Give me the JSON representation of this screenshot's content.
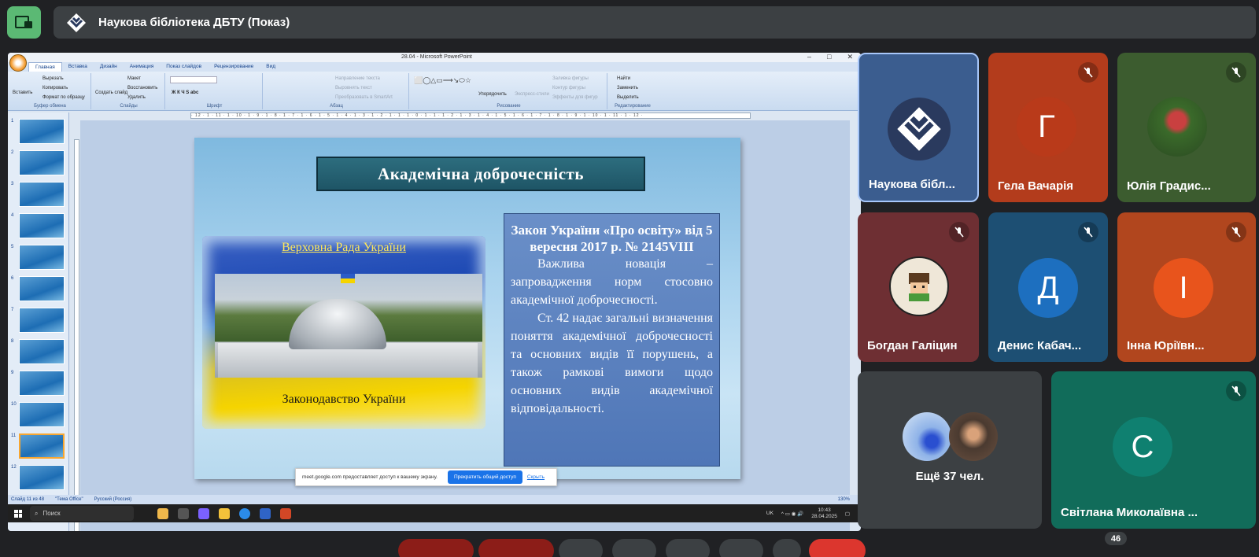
{
  "meeting": {
    "title": "Наукова бібліотека ДБТУ (Показ)",
    "present_icon": "present-screen-icon",
    "participant_count": "46"
  },
  "powerpoint": {
    "window_title": "28.04 - Microsoft PowerPoint",
    "tabs": [
      "Главная",
      "Вставка",
      "Дизайн",
      "Анимация",
      "Показ слайдов",
      "Рецензирование",
      "Вид"
    ],
    "ribbon": {
      "clipboard": {
        "label": "Буфер обмена",
        "paste": "Вставить",
        "cut": "Вырезать",
        "copy": "Копировать",
        "format": "Формат по образцу"
      },
      "slides": {
        "label": "Слайды",
        "new": "Создать слайд",
        "layout": "Макет",
        "reset": "Восстановить",
        "delete": "Удалить"
      },
      "font": {
        "label": "Шрифт"
      },
      "paragraph": {
        "label": "Абзац",
        "direction": "Направление текста",
        "align": "Выровнять текст",
        "smartart": "Преобразовать в SmartArt"
      },
      "drawing": {
        "label": "Рисование",
        "arrange": "Упорядочить",
        "styles": "Экспресс-стили",
        "fill": "Заливка фигуры",
        "outline": "Контур фигуры",
        "effects": "Эффекты для фигур"
      },
      "editing": {
        "label": "Редактирование",
        "find": "Найти",
        "replace": "Заменить",
        "select": "Выделить"
      }
    },
    "ruler_text": "· 12 · 1 · 11 · 1 · 10 · 1 · 9 · 1 · 8 · 1 · 7 · 1 · 6 · 1 · 5 · 1 · 4 · 1 · 3 · 1 · 2 · 1 · 1 · 1 · 0 · 1 · 1 · 1 · 2 · 1 · 3 · 1 · 4 · 1 · 5 · 1 · 6 · 1 · 7 · 1 · 8 · 1 · 9 · 1 · 10 · 1 · 11 · 1 · 12 ·",
    "thumb_numbers": [
      "1",
      "2",
      "3",
      "4",
      "5",
      "6",
      "7",
      "8",
      "9",
      "10",
      "11",
      "12"
    ],
    "selected_thumb": "11",
    "slide": {
      "title": "Академічна доброчесність",
      "flag_top": "Верховна Рада України",
      "flag_bottom": "Законодавство України",
      "law_heading": "Закон України «Про освіту» від 5 вересня 2017 р. № 2145VIII",
      "law_p1": "Важлива новація – запровадження норм стосовно академічної доброчесності.",
      "law_p2": "Ст. 42 надає загальні визначення поняття академічної доброчесності та основних видів її порушень, а також рамкові вимоги щодо основних видів академічної відповідальності."
    },
    "status": {
      "slide": "Слайд 11 из 48",
      "theme": "\"Тема Office\"",
      "lang": "Русский (Россия)",
      "zoom": "130%"
    }
  },
  "share_bar": {
    "text": "meet.google.com предоставляет доступ к вашему экрану.",
    "stop": "Прекратить общий доступ",
    "hide": "Скрыть"
  },
  "taskbar": {
    "search": "Поиск",
    "lang": "UK",
    "time": "10:43",
    "date": "28.04.2025"
  },
  "participants": [
    {
      "name": "Наукова бібл...",
      "color": "#3b5d8f"
    },
    {
      "name": "Гела Вачарія",
      "initial": "Г",
      "color": "#b33c1c",
      "avatar": "#b93a1a"
    },
    {
      "name": "Юлія Градис...",
      "color": "#3c5c2f"
    },
    {
      "name": "Богдан Галіцин",
      "color": "#6e2f33"
    },
    {
      "name": "Денис Кабач...",
      "initial": "Д",
      "color": "#1d4f73",
      "avatar": "#1d6fbf"
    },
    {
      "name": "Інна Юріївн...",
      "initial": "І",
      "color": "#b1461e",
      "avatar": "#e8541c"
    },
    {
      "name": "Ещё 37 чел.",
      "color": "#3c4043"
    },
    {
      "name": "Світлана Миколаївна ...",
      "initial": "С",
      "color": "#116c5a",
      "avatar": "#0f8070"
    }
  ]
}
